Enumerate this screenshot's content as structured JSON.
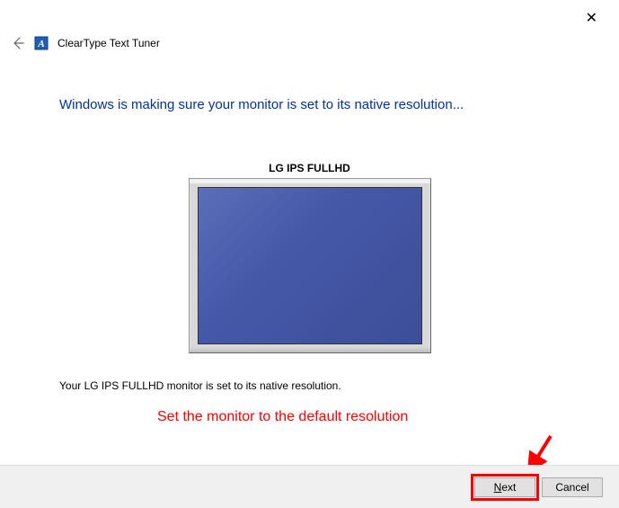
{
  "window": {
    "title": "ClearType Text Tuner",
    "close_label": "✕"
  },
  "heading": "Windows is making sure your monitor is set to its native resolution...",
  "monitor": {
    "name": "LG IPS FULLHD"
  },
  "status": "Your LG IPS FULLHD monitor is set to its native resolution.",
  "annotation": "Set the monitor to the default resolution",
  "buttons": {
    "next_prefix": "N",
    "next_rest": "ext",
    "cancel": "Cancel"
  }
}
